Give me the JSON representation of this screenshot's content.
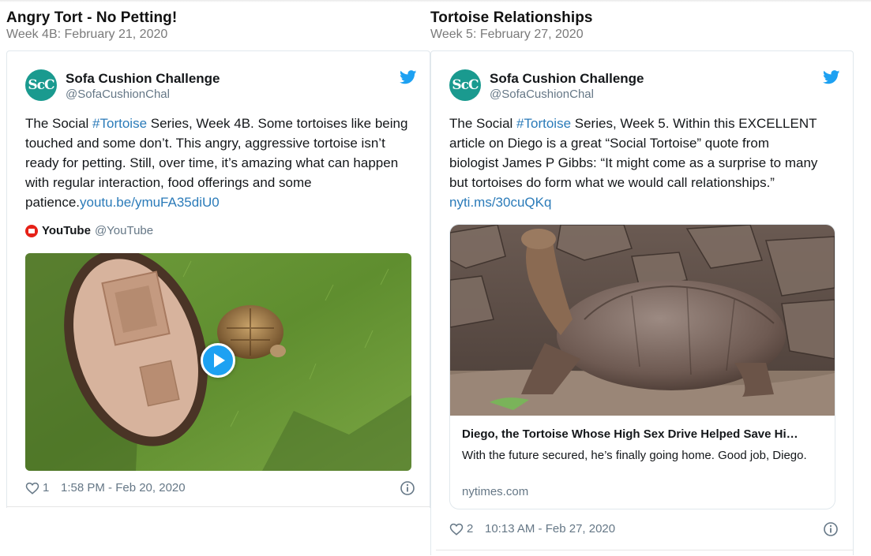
{
  "posts": [
    {
      "title": "Angry Tort - No Petting!",
      "date": "Week 4B: February 21, 2020",
      "tweet": {
        "avatar_text": "ScC",
        "author_name": "Sofa Cushion Challenge",
        "author_handle": "@SofaCushionChal",
        "text_before": "The Social ",
        "hashtag": "#Tortoise",
        "text_after": " Series, Week 4B.  Some tortoises like being touched and some don’t.  This angry, aggressive tortoise isn’t ready for petting.  Still, over time, it’s amazing what can happen with regular interaction, food offerings and some patience.",
        "link": "youtu.be/ymuFA35diU0",
        "source_name": "YouTube",
        "source_handle": "@YouTube",
        "likes": "1",
        "timestamp": "1:58 PM - Feb 20, 2020"
      }
    },
    {
      "title": "Tortoise Relationships",
      "date": "Week 5: February 27, 2020",
      "tweet": {
        "avatar_text": "ScC",
        "author_name": "Sofa Cushion Challenge",
        "author_handle": "@SofaCushionChal",
        "text_before": "The Social ",
        "hashtag": "#Tortoise",
        "text_after": " Series, Week 5. Within this EXCELLENT article on Diego is a great “Social Tortoise” quote from biologist James P Gibbs: “It might come as a surprise to many but tortoises do form what we would call relationships.” ",
        "link": "nyti.ms/30cuQKq",
        "card": {
          "title": "Diego, the Tortoise Whose High Sex Drive Helped Save Hi…",
          "description": "With the future secured, he’s finally going home. Good job, Diego.",
          "domain": "nytimes.com"
        },
        "likes": "2",
        "timestamp": "10:13 AM - Feb 27, 2020"
      }
    }
  ],
  "colors": {
    "twitter_blue": "#1da1f2",
    "link_blue": "#2b7bb9",
    "avatar_teal": "#1a9a8f",
    "muted_gray": "#657786",
    "youtube_red": "#e62117"
  },
  "icons": [
    "twitter-bird-icon",
    "youtube-icon",
    "heart-icon",
    "info-icon",
    "play-icon"
  ]
}
